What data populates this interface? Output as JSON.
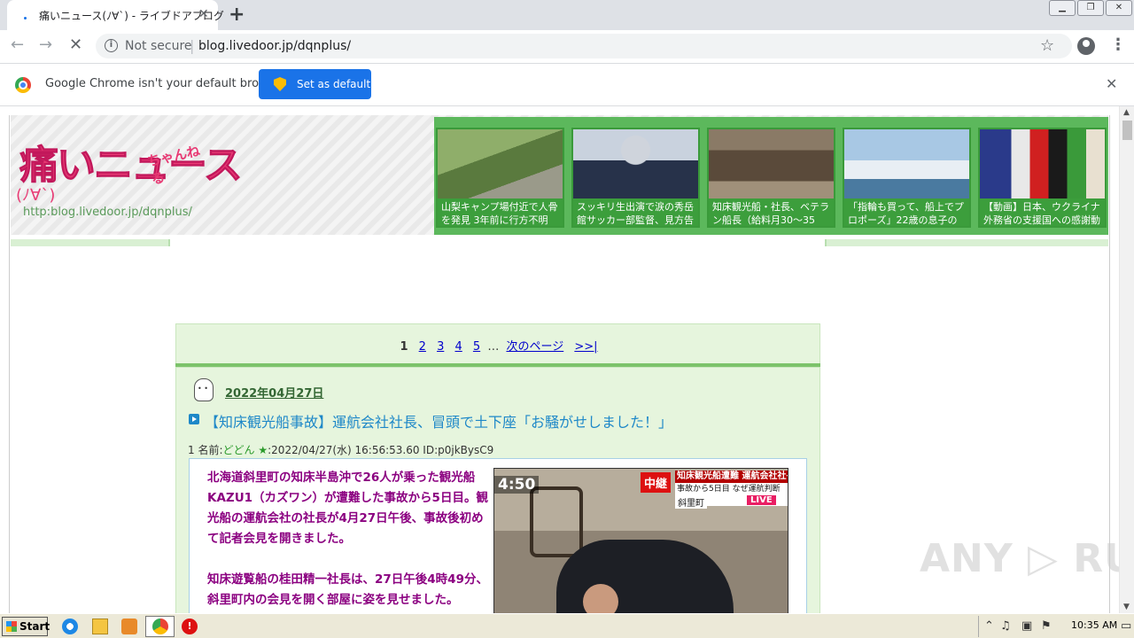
{
  "browser": {
    "tab_title": "痛いニュース(ﾉ∀`) - ライブドアブログ",
    "tab_close": "✕",
    "new_tab": "+",
    "window_buttons": [
      "▁",
      "❐",
      "✕"
    ],
    "back": "←",
    "forward": "→",
    "reload": "✕",
    "security_label": "Not secure",
    "url": "blog.livedoor.jp/dqnplus/",
    "bookmark_star": "☆",
    "menu": "⋮"
  },
  "infobar": {
    "message": "Google Chrome isn't your default browser",
    "button_label": "Set as default",
    "close": "✕"
  },
  "blog": {
    "logo_main": "痛いニュース",
    "logo_sub": "ちゃんねる",
    "logo_face": "(ﾉ∀`)",
    "logo_url": "http:blog.livedoor.jp/dqnplus/",
    "thumbnails": [
      {
        "caption": "山梨キャンプ場付近で人骨を発見 3年前に行方不明",
        "color1": "#7a9a5a",
        "color2": "#4a6a3a"
      },
      {
        "caption": "スッキリ生出演で涙の秀岳館サッカー部監督、見方告",
        "color1": "#bcc6d4",
        "color2": "#2a3550"
      },
      {
        "caption": "知床観光船・社長、ベテラン船長（給料月30～35",
        "color1": "#8a7a66",
        "color2": "#3a3026"
      },
      {
        "caption": "「指輪も買って、船上でプロポーズ」22歳の息子の",
        "color1": "#9fc3e0",
        "color2": "#e8eef4"
      },
      {
        "caption": "【動画】日本、ウクライナ外務省の支援国への感謝動",
        "color1": "#d0c8b8",
        "color2": "#b02020"
      }
    ]
  },
  "pager": {
    "current": "1",
    "pages": [
      "2",
      "3",
      "4",
      "5"
    ],
    "dots": "…",
    "next_label": "次のページ",
    "last_label": ">>|"
  },
  "article": {
    "date": "2022年04月27日",
    "title": "【知床観光船事故】運航会社社長、冒頭で土下座「お騒がせしました！」",
    "post_number": "1",
    "name_label": "名前:",
    "name": "どどん",
    "star": "★",
    "post_info": ":2022/04/27(水) 16:56:53.60 ID:p0jkBysC9",
    "paragraphs": [
      "北海道斜里町の知床半島沖で26人が乗った観光船KAZU1（カズワン）が遭難した事故から5日目。観光船の運航会社の社長が4月27日午後、事故後初めて記者会見を開きました。",
      "知床遊覧船の桂田精一社長は、27日午後4時49分、斜里町内の会見を開く部屋に姿を見せました。"
    ],
    "image": {
      "clock": "4:50",
      "live_badge": "中継",
      "banner_top": "知床観光船遭難 運航会社社長が",
      "banner_bottom": "事故から5日目 なぜ運航判断",
      "location": "斜里町",
      "live": "LIVE"
    }
  },
  "watermark": "ANY ▷ RUN",
  "taskbar": {
    "start_label": "Start",
    "clock": "10:35 AM"
  }
}
